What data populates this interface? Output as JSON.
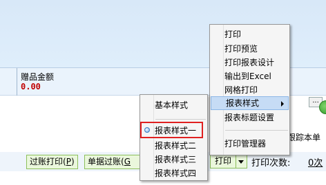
{
  "gift_panel": {
    "label": "赠品金额",
    "value": "0.00"
  },
  "buttons": {
    "post_print": "过账打印(",
    "post_print_key": "P",
    "post_print_close": ")",
    "doc_post": "单据过账(",
    "doc_post_key": "G",
    "print": "打印",
    "print_count_label": "打印次数:",
    "print_count_value": "0次"
  },
  "track_text": "跟踪本单",
  "ellipsis": "...",
  "main_menu": {
    "items": [
      "打印",
      "打印预览",
      "打印报表设计",
      "输出到Excel",
      "网格打印",
      "报表样式",
      "报表标题设置",
      "打印管理器"
    ],
    "highlighted": "报表样式"
  },
  "sub_menu": {
    "items": [
      "基本样式",
      "报表样式一",
      "报表样式二",
      "报表样式三",
      "报表样式四"
    ],
    "selected": "报表样式一"
  }
}
